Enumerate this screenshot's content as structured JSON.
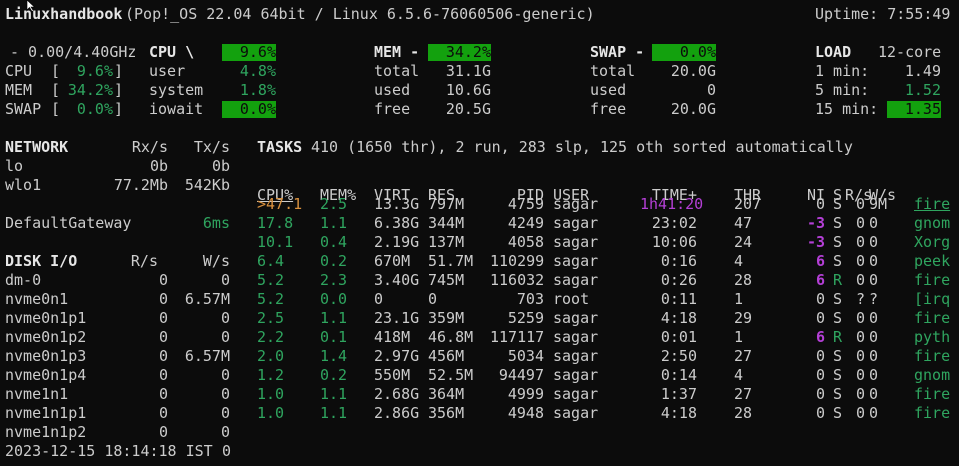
{
  "header": {
    "host": "Linuxhandbook",
    "sysinfo": "(Pop!_OS 22.04 64bit / Linux 6.5.6-76060506-generic)",
    "uptime": "Uptime: 7:55:49"
  },
  "cpu": {
    "freq": "- 0.00/4.40GHz",
    "title": "CPU \\",
    "pct": "9.6%",
    "rows": [
      {
        "label": "CPU",
        "val": "9.6%",
        "k": "user",
        "v": "4.8%"
      },
      {
        "label": "MEM",
        "val": "34.2%",
        "k": "system",
        "v": "1.8%"
      },
      {
        "label": "SWAP",
        "val": "0.0%",
        "k": "iowait",
        "v": "0.0%"
      }
    ]
  },
  "mem": {
    "title": "MEM -",
    "pct": "34.2%",
    "rows": [
      {
        "k": "total",
        "v": "31.1G"
      },
      {
        "k": "used",
        "v": "10.6G"
      },
      {
        "k": "free",
        "v": "20.5G"
      }
    ]
  },
  "swap": {
    "title": "SWAP -",
    "pct": "0.0%",
    "rows": [
      {
        "k": "total",
        "v": "20.0G"
      },
      {
        "k": "used",
        "v": "0"
      },
      {
        "k": "free",
        "v": "20.0G"
      }
    ]
  },
  "load": {
    "title": "LOAD",
    "cores": "12-core",
    "rows": [
      {
        "k": "1 min:",
        "v": "1.49"
      },
      {
        "k": "5 min:",
        "v": "1.52"
      },
      {
        "k": "15 min:",
        "v": "1.35"
      }
    ]
  },
  "network": {
    "title": "NETWORK",
    "rx": "Rx/s",
    "tx": "Tx/s",
    "rows": [
      {
        "n": "lo",
        "rx": "0b",
        "tx": "0b"
      },
      {
        "n": "wlo1",
        "rx": "77.2Mb",
        "tx": "542Kb"
      }
    ],
    "gateway": "DefaultGateway",
    "gateway_val": "6ms"
  },
  "disk": {
    "title": "DISK I/O",
    "r": "R/s",
    "w": "W/s",
    "rows": [
      {
        "n": "dm-0",
        "r": "0",
        "w": "0"
      },
      {
        "n": "nvme0n1",
        "r": "0",
        "w": "6.57M"
      },
      {
        "n": "nvme0n1p1",
        "r": "0",
        "w": "0"
      },
      {
        "n": "nvme0n1p2",
        "r": "0",
        "w": "0"
      },
      {
        "n": "nvme0n1p3",
        "r": "0",
        "w": "6.57M"
      },
      {
        "n": "nvme0n1p4",
        "r": "0",
        "w": "0"
      },
      {
        "n": "nvme1n1",
        "r": "0",
        "w": "0"
      },
      {
        "n": "nvme1n1p1",
        "r": "0",
        "w": "0"
      },
      {
        "n": "nvme1n1p2",
        "r": "0",
        "w": "0"
      }
    ]
  },
  "footer": {
    "datetime": "2023-12-15 18:14:18 IST",
    "extra": "0"
  },
  "tasks": {
    "label": "TASKS",
    "summary": "410 (1650 thr), 2 run, 283 slp, 125 oth sorted automatically",
    "columns": {
      "cpu": "CPU%",
      "mem": "MEM%",
      "virt": "VIRT",
      "res": "RES",
      "pid": "PID",
      "user": "USER",
      "time": "TIME+",
      "thr": "THR",
      "ni": "NI",
      "s": "S",
      "rs": "R/s",
      "ws": "W/s"
    },
    "processes": [
      {
        "cpu": ">47.1",
        "mem": "2.5",
        "virt": "13.3G",
        "res": "797M",
        "pid": "4759",
        "user": "sagar",
        "time": "1h41:20",
        "thr": "207",
        "ni": "0",
        "s": "S",
        "rs": "0",
        "ws": "9M",
        "cmd": "fire"
      },
      {
        "cpu": "17.8",
        "mem": "1.1",
        "virt": "6.38G",
        "res": "344M",
        "pid": "4249",
        "user": "sagar",
        "time": "23:02",
        "thr": "47",
        "ni": "-3",
        "s": "S",
        "rs": "0",
        "ws": "0",
        "cmd": "gnom"
      },
      {
        "cpu": "10.1",
        "mem": "0.4",
        "virt": "2.19G",
        "res": "137M",
        "pid": "4058",
        "user": "sagar",
        "time": "10:06",
        "thr": "24",
        "ni": "-3",
        "s": "S",
        "rs": "0",
        "ws": "0",
        "cmd": "Xorg"
      },
      {
        "cpu": "6.4",
        "mem": "0.2",
        "virt": "670M",
        "res": "51.7M",
        "pid": "110299",
        "user": "sagar",
        "time": "0:16",
        "thr": "4",
        "ni": "6",
        "s": "S",
        "rs": "0",
        "ws": "0",
        "cmd": "peek"
      },
      {
        "cpu": "5.2",
        "mem": "2.3",
        "virt": "3.40G",
        "res": "745M",
        "pid": "116032",
        "user": "sagar",
        "time": "0:26",
        "thr": "28",
        "ni": "6",
        "s": "R",
        "rs": "0",
        "ws": "0",
        "cmd": "fire"
      },
      {
        "cpu": "5.2",
        "mem": "0.0",
        "virt": "0",
        "res": "0",
        "pid": "703",
        "user": "root",
        "time": "0:11",
        "thr": "1",
        "ni": "0",
        "s": "S",
        "rs": "?",
        "ws": "?",
        "cmd": "[irq"
      },
      {
        "cpu": "2.5",
        "mem": "1.1",
        "virt": "23.1G",
        "res": "359M",
        "pid": "5259",
        "user": "sagar",
        "time": "4:18",
        "thr": "29",
        "ni": "0",
        "s": "S",
        "rs": "0",
        "ws": "0",
        "cmd": "fire"
      },
      {
        "cpu": "2.2",
        "mem": "0.1",
        "virt": "418M",
        "res": "46.8M",
        "pid": "117117",
        "user": "sagar",
        "time": "0:01",
        "thr": "1",
        "ni": "6",
        "s": "R",
        "rs": "0",
        "ws": "0",
        "cmd": "pyth"
      },
      {
        "cpu": "2.0",
        "mem": "1.4",
        "virt": "2.97G",
        "res": "456M",
        "pid": "5034",
        "user": "sagar",
        "time": "2:50",
        "thr": "27",
        "ni": "0",
        "s": "S",
        "rs": "0",
        "ws": "0",
        "cmd": "fire"
      },
      {
        "cpu": "1.2",
        "mem": "0.2",
        "virt": "550M",
        "res": "52.5M",
        "pid": "94497",
        "user": "sagar",
        "time": "0:14",
        "thr": "4",
        "ni": "0",
        "s": "S",
        "rs": "0",
        "ws": "0",
        "cmd": "gnom"
      },
      {
        "cpu": "1.0",
        "mem": "1.1",
        "virt": "2.68G",
        "res": "364M",
        "pid": "4999",
        "user": "sagar",
        "time": "1:37",
        "thr": "27",
        "ni": "0",
        "s": "S",
        "rs": "0",
        "ws": "0",
        "cmd": "fire"
      },
      {
        "cpu": "1.0",
        "mem": "1.1",
        "virt": "2.86G",
        "res": "356M",
        "pid": "4948",
        "user": "sagar",
        "time": "4:18",
        "thr": "28",
        "ni": "0",
        "s": "S",
        "rs": "0",
        "ws": "0",
        "cmd": "fire"
      }
    ]
  },
  "colors": {
    "bg": "#0c0c0c",
    "fg": "#cccccc",
    "green": "#2fa55f",
    "magenta": "#b43fd6",
    "orange": "#d8903e"
  }
}
